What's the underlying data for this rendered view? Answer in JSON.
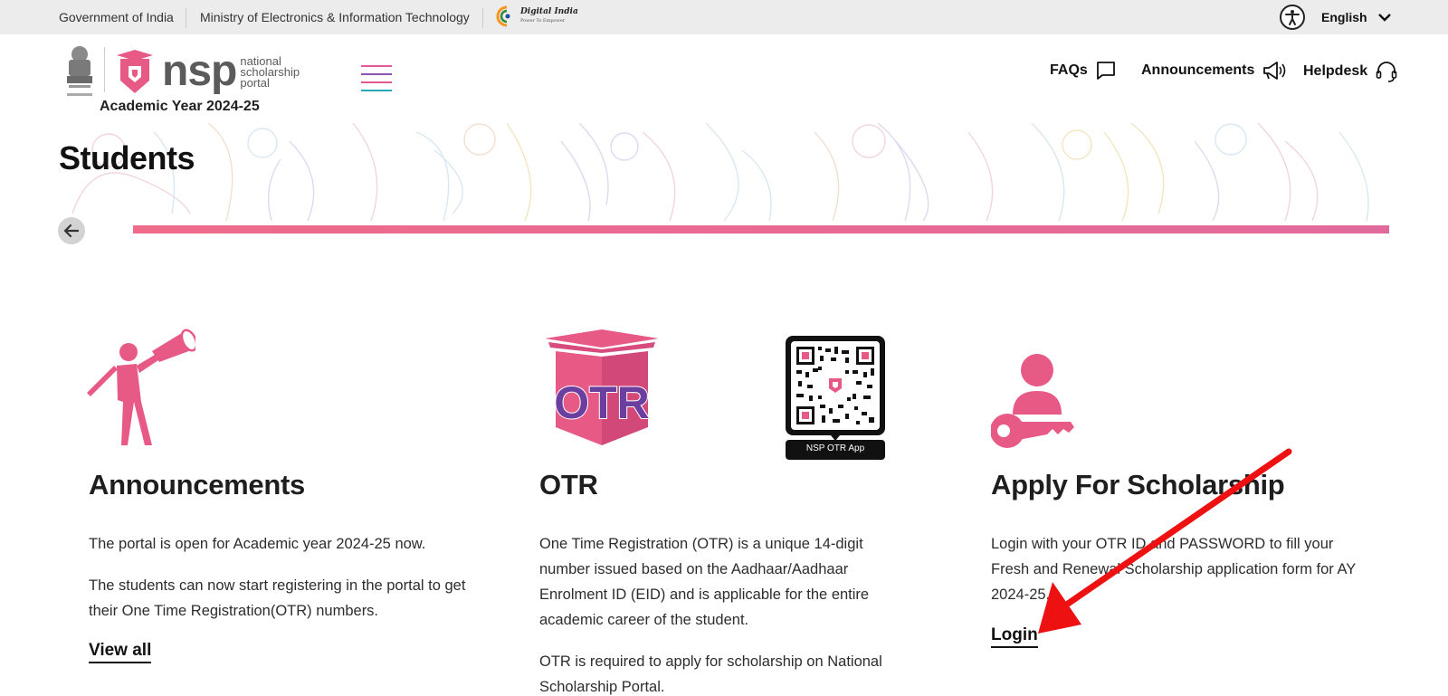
{
  "gov_bar": {
    "gov_india": "Government of India",
    "ministry": "Ministry of Electronics & Information Technology",
    "digital_india": "Digital India",
    "digital_india_tagline": "Power To Empower",
    "language": "English"
  },
  "header": {
    "logo_letters": "nsp",
    "logo_line1": "national",
    "logo_line2": "scholarship",
    "logo_line3": "portal",
    "academic_year": "Academic Year 2024-25",
    "nav": {
      "faqs": "FAQs",
      "announcements": "Announcements",
      "helpdesk": "Helpdesk"
    }
  },
  "page": {
    "title": "Students"
  },
  "cards": {
    "announcements": {
      "title": "Announcements",
      "p1": "The portal is open for Academic year 2024-25 now.",
      "p2": "The students can now start registering in the portal to get their One Time Registration(OTR) numbers.",
      "link": "View all"
    },
    "otr": {
      "title": "OTR",
      "logo_text": "OTR",
      "qr_caption": "NSP OTR App",
      "p1": "One Time Registration (OTR) is a unique 14-digit number issued based on the Aadhaar/Aadhaar Enrolment ID (EID) and is applicable for the entire academic career of the student.",
      "p2": "OTR is required to apply for scholarship on National Scholarship Portal."
    },
    "apply": {
      "title": "Apply For Scholarship",
      "p1": "Login with your OTR ID and PASSWORD to fill your Fresh and Renewal Scholarship application form for AY 2024-25.",
      "link": "Login"
    }
  },
  "colors": {
    "brand_pink": "#e85a86",
    "brand_purple": "#6a3fa0",
    "annotation_red": "#ee1111"
  }
}
